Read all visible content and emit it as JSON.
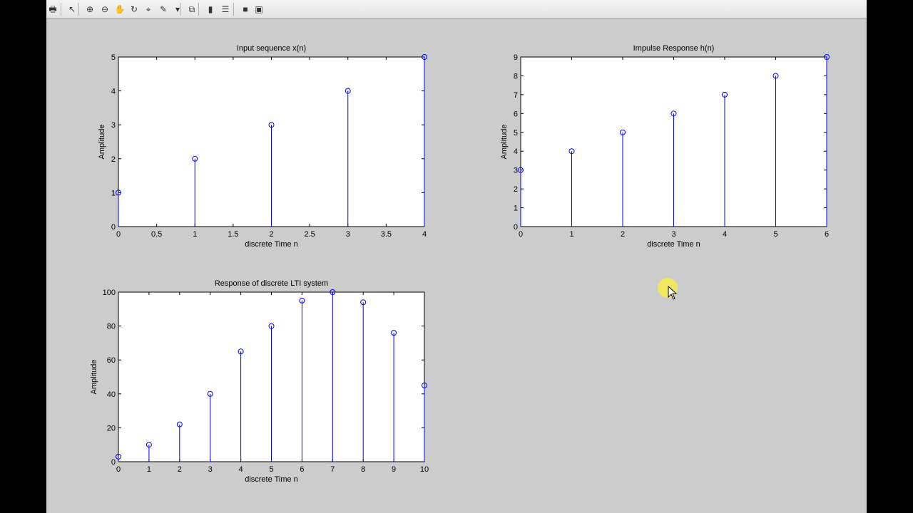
{
  "toolbar": {
    "buttons": [
      {
        "name": "print-icon",
        "glyph": "🖶"
      },
      {
        "name": "pointer-icon",
        "glyph": "↖"
      },
      {
        "name": "zoom-in-icon",
        "glyph": "⊕"
      },
      {
        "name": "zoom-out-icon",
        "glyph": "⊖"
      },
      {
        "name": "pan-hand-icon",
        "glyph": "✋"
      },
      {
        "name": "rotate-3d-icon",
        "glyph": "↻"
      },
      {
        "name": "data-cursor-icon",
        "glyph": "⌖"
      },
      {
        "name": "brush-icon",
        "glyph": "✎"
      },
      {
        "name": "dropdown-arrow-icon",
        "glyph": "▾"
      },
      {
        "name": "link-plot-icon",
        "glyph": "⧉"
      },
      {
        "name": "colorbar-icon",
        "glyph": "▮"
      },
      {
        "name": "legend-icon",
        "glyph": "☰"
      },
      {
        "name": "hide-plot-tools-icon",
        "glyph": "■"
      },
      {
        "name": "show-plot-tools-icon",
        "glyph": "▣"
      }
    ]
  },
  "colors": {
    "figure_bg": "#cccccc",
    "axes_bg": "#ffffff",
    "stem": "#0000ff",
    "text": "#000000"
  },
  "chart_data": [
    {
      "type": "stem",
      "title": "Input sequence x(n)",
      "xlabel": "discrete Time n",
      "ylabel": "Amplitude",
      "x": [
        0,
        1,
        2,
        3,
        4
      ],
      "y": [
        1,
        2,
        3,
        4,
        5
      ],
      "xlim": [
        0,
        4
      ],
      "ylim": [
        0,
        5
      ],
      "xticks": [
        "0",
        "0.5",
        "1",
        "1.5",
        "2",
        "2.5",
        "3",
        "3.5",
        "4"
      ],
      "yticks": [
        "0",
        "1",
        "2",
        "3",
        "4",
        "5"
      ],
      "grid": false
    },
    {
      "type": "stem",
      "title": "Impulse Response h(n)",
      "xlabel": "discrete Time n",
      "ylabel": "Amplitude",
      "x": [
        0,
        1,
        2,
        3,
        4,
        5,
        6
      ],
      "y": [
        3,
        4,
        5,
        6,
        7,
        8,
        9
      ],
      "xlim": [
        0,
        6
      ],
      "ylim": [
        0,
        9
      ],
      "xticks": [
        "0",
        "1",
        "2",
        "3",
        "4",
        "5",
        "6"
      ],
      "yticks": [
        "0",
        "1",
        "2",
        "3",
        "4",
        "5",
        "6",
        "7",
        "8",
        "9"
      ],
      "grid": false
    },
    {
      "type": "stem",
      "title": "Response of discrete LTI system",
      "xlabel": "discrete Time n",
      "ylabel": "Amplitude",
      "x": [
        0,
        1,
        2,
        3,
        4,
        5,
        6,
        7,
        8,
        9,
        10
      ],
      "y": [
        3,
        10,
        22,
        40,
        65,
        80,
        95,
        100,
        94,
        76,
        45
      ],
      "xlim": [
        0,
        10
      ],
      "ylim": [
        0,
        100
      ],
      "xticks": [
        "0",
        "1",
        "2",
        "3",
        "4",
        "5",
        "6",
        "7",
        "8",
        "9",
        "10"
      ],
      "yticks": [
        "0",
        "20",
        "40",
        "60",
        "80",
        "100"
      ],
      "grid": false
    }
  ]
}
